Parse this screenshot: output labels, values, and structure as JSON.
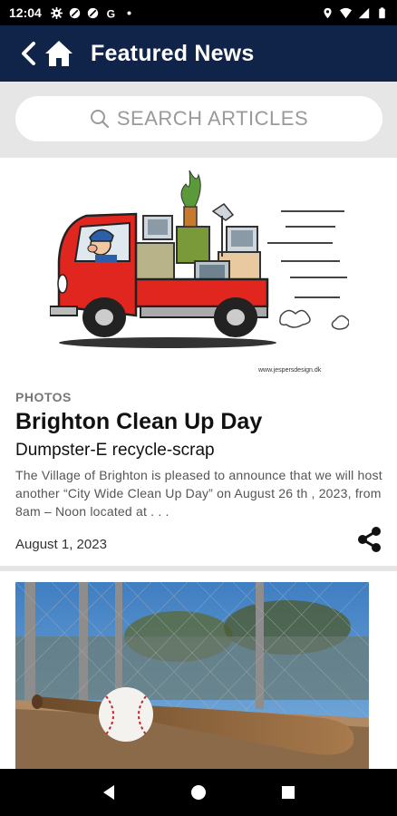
{
  "status_bar": {
    "time": "12:04",
    "left_icons": [
      "gear-icon",
      "slash-circle-icon",
      "slash-circle-icon",
      "g-icon",
      "dot-icon"
    ],
    "right_icons": [
      "location-icon",
      "wifi-icon",
      "signal-icon",
      "battery-icon"
    ]
  },
  "app_bar": {
    "title": "Featured News",
    "background": "#10244a"
  },
  "search": {
    "placeholder": "SEARCH ARTICLES"
  },
  "articles": [
    {
      "category": "PHOTOS",
      "title": "Brighton Clean Up Day",
      "subtitle": "Dumpster-E recycle-scrap",
      "excerpt": "  The Village of Brighton is pleased to announce that we will host another “City Wide Clean Up Day” on August 26 th , 2023, from 8am – Noon located at . . .",
      "date": "August 1, 2023",
      "image": "cartoon-truck-junk",
      "image_credit": "www.jespersdesign.dk"
    },
    {
      "image": "baseball-and-bat-on-bench"
    }
  ],
  "nav_bar": {
    "buttons": [
      "back-triangle-icon",
      "home-circle-icon",
      "recents-square-icon"
    ]
  }
}
